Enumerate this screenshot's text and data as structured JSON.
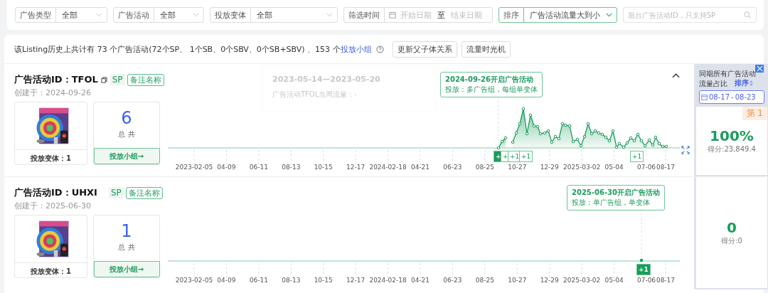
{
  "filters": [
    {
      "kind": "select",
      "label": "广告类型",
      "value": "全部"
    },
    {
      "kind": "select",
      "label": "广告活动",
      "value": "全部"
    },
    {
      "kind": "select",
      "label": "投放变体",
      "value": "全部"
    },
    {
      "kind": "daterange",
      "label": "筛选时间",
      "start_placeholder": "开始日期",
      "separator": "至",
      "end_placeholder": "结束日期"
    },
    {
      "kind": "sort",
      "label": "排序",
      "value": "广告活动流量大到小"
    },
    {
      "kind": "search",
      "placeholder": "后台广告活动ID，只支持SP"
    }
  ],
  "summary": {
    "text": "该Listing历史上共计有 73 个广告活动(72个SP、 1个SB、0个SBV、0个SB+SBV) 、153 个",
    "link": "投放小组"
  },
  "actions": [
    "更新父子体关系",
    "流量时光机"
  ],
  "side_header": {
    "title_lines": [
      "同期所有广告活动",
      "流量占比"
    ],
    "sort": "排序",
    "date_start": "08-17",
    "date_sep": "-",
    "date_end": "08-23"
  },
  "campaigns": [
    {
      "ticks": [
        "2023-02-05",
        "04-09",
        "06-11",
        "08-13",
        "10-15",
        "12-17",
        "2024-02-18",
        "04-21",
        "06-23",
        "08-25",
        "10-27",
        "12-29",
        "2025-03-02",
        "05-04",
        "07-06",
        "08-17"
      ],
      "title": "广告活动ID：TFOL",
      "copyable": true,
      "type": "SP",
      "note": "备注名称",
      "created": "创建于：2024-09-26",
      "variants": "投放变体：1",
      "count": "6",
      "count_label": "总 共",
      "group_button": "投放小组→",
      "has_traffic": true,
      "ghost_tooltip": {
        "title": "2023-05-14—2023-05-20",
        "body": "广告活动TFOL当周流量：-"
      },
      "callout": {
        "title": "2024-09-26开启广告活动",
        "body": "投放：多广告组，每组单变体"
      },
      "markers": [
        {
          "label": "+",
          "selected": true
        },
        {
          "label": "+",
          "selected": false
        },
        {
          "label": "+1",
          "selected": false
        },
        {
          "label": "+1",
          "selected": false
        },
        {
          "label": "+1",
          "selected": false
        }
      ],
      "collapsible": true,
      "rank": "第 1",
      "share": "100%",
      "score": "得分:23,849.4"
    },
    {
      "ticks": [
        "2023-02-05",
        "04-09",
        "06-11",
        "08-13",
        "10-15",
        "12-17",
        "2024-02-18",
        "04-21",
        "06-23",
        "08-25",
        "10-27",
        "12-29",
        "2025-03-02",
        "05-04",
        "07-06",
        "08-17"
      ],
      "title": "广告活动ID：UHXI",
      "copyable": false,
      "type": "SP",
      "note": "备注名称",
      "created": "创建于：2025-06-30",
      "variants": "投放变体：1",
      "count": "1",
      "count_label": "总 共",
      "group_button": "投放小组→",
      "has_traffic": false,
      "callout": {
        "title": "2025-06-30开启广告活动",
        "body": "投放：单广告组，单变体"
      },
      "markers": [
        {
          "label": "+1",
          "selected": true
        }
      ],
      "collapsible": false,
      "share": "0",
      "score": "得分:0"
    }
  ]
}
